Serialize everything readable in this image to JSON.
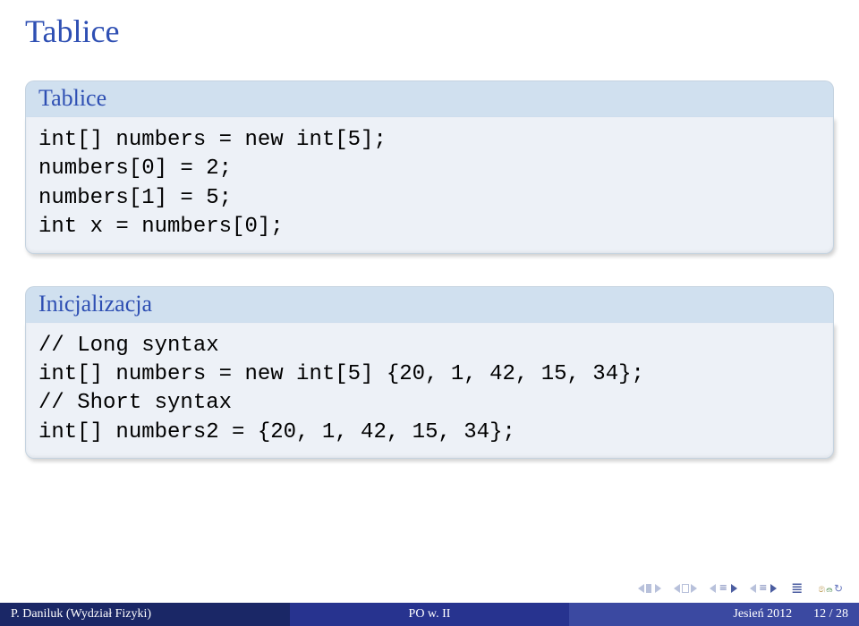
{
  "title": "Tablice",
  "blocks": {
    "b1": {
      "title": "Tablice",
      "lines": {
        "l1": "int[] numbers = new int[5];",
        "l2": "numbers[0] = 2;",
        "l3": "numbers[1] = 5;",
        "l4": "int x = numbers[0];"
      }
    },
    "b2": {
      "title": "Inicjalizacja",
      "lines": {
        "l1": "// Long syntax",
        "l2": "int[] numbers = new int[5] {20, 1, 42, 15, 34};",
        "l3": "// Short syntax",
        "l4": "int[] numbers2 = {20, 1, 42, 15, 34};"
      }
    }
  },
  "footer": {
    "left": "P. Daniluk (Wydział Fizyki)",
    "mid": "PO w. II",
    "right_term": "Jesień 2012",
    "right_page": "12 / 28"
  }
}
